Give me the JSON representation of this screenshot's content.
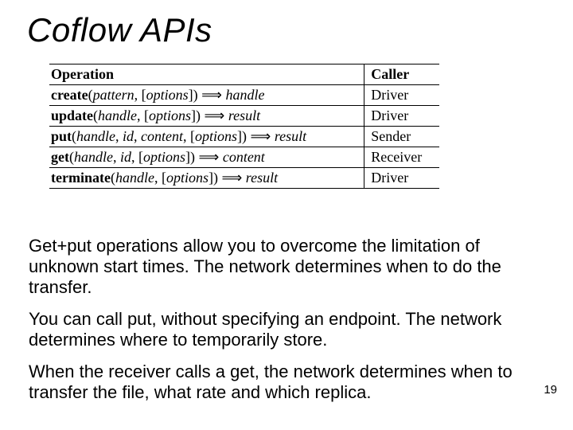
{
  "title": "Coflow APIs",
  "table": {
    "headers": {
      "op": "Operation",
      "caller": "Caller"
    },
    "rows": [
      {
        "fn": "create",
        "argsHtml": "<span class='it'>pattern</span>, [<span class='it'>options</span>]",
        "ret": "handle",
        "caller": "Driver"
      },
      {
        "fn": "update",
        "argsHtml": "<span class='it'>handle</span>, [<span class='it'>options</span>]",
        "ret": "result",
        "caller": "Driver"
      },
      {
        "fn": "put",
        "argsHtml": "<span class='it'>handle</span>, <span class='it'>id</span>, <span class='it'>content</span>, [<span class='it'>options</span>]",
        "ret": "result",
        "caller": "Sender"
      },
      {
        "fn": "get",
        "argsHtml": "<span class='it'>handle</span>, <span class='it'>id</span>, [<span class='it'>options</span>]",
        "ret": "content",
        "caller": "Receiver"
      },
      {
        "fn": "terminate",
        "argsHtml": "<span class='it'>handle</span>, [<span class='it'>options</span>]",
        "ret": "result",
        "caller": "Driver"
      }
    ]
  },
  "paragraphs": {
    "p1": "Get+put operations allow you to overcome the limitation of unknown start times.  The network determines when to do the transfer.",
    "p2": "You can call put, without specifying an endpoint. The network determines where to temporarily store.",
    "p3": "When the receiver calls a get, the network determines when to transfer the file, what rate and which replica."
  },
  "pageNumber": "19"
}
